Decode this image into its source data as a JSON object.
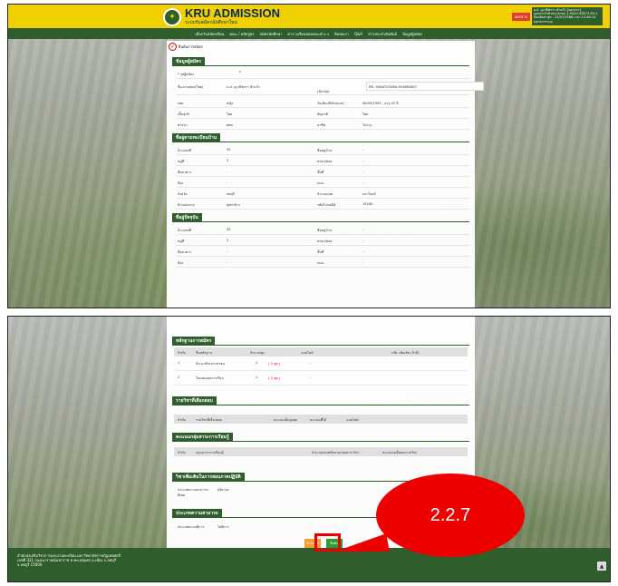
{
  "header": {
    "title": "KRU ADMISSION",
    "subtitle": "ระบบรับสมัครนักศึกษาใหม่",
    "user_badge": "ออกจาก",
    "user_lines": [
      "ผ.ส. ญาณีพรรา คำแก้ว [ออกจาก]",
      "เลขประจำตัวประชาชน 1-9420-47873-39-1",
      "ล็อคอินล่าสุด : 22/07/2566 เวลา 13:46:14",
      "ออกจากระบบ"
    ]
  },
  "nav": [
    "เลือกรับสมัครเรียน",
    "คณะ / หลักสูตร",
    "สมัครนักศึกษา",
    "ตารางเรียนของคณะต่าง ๆ",
    "ติดต่อเรา",
    "Q&A",
    "ข่าวประชาสัมพันธ์",
    "ข้อมูลผู้สมัคร"
  ],
  "confirm_label": "ยืนยันการสมัคร",
  "sections": {
    "applicant": "ข้อมูลผู้สมัคร",
    "house": "ที่อยู่ตามทะเบียนบ้าน",
    "current": "ที่อยู่ปัจจุบัน",
    "evidence": "หลักฐานการสมัคร",
    "subjects": "รายวิชาที่เลือกสอบ",
    "scores": "คะแนนกลุ่มสาระการเรียนรู้",
    "special": "วิชาเพิ่มเติมในการสอบภาคปฏิบัติ",
    "talent": "ประเภทความสามารถ"
  },
  "applicant": {
    "photo_label": "* รูปผู้สมัคร",
    "name_th_label": "ชื่อ-นามสกุล(ไทย)",
    "name_th": "น.ส. ญาณีพรรา คำแก้ว",
    "name_en_label": "(อังกฤษ)",
    "name_en": "MS. YANATCHARA KHAMKAEO",
    "sex_label": "เพศ",
    "sex": "หญิง",
    "dob_label": "วันเดือนปีเกิด(ค.ศ.)",
    "dob": "08/09/1999 , อายุ 22 ปี",
    "race_label": "เชื้อชาติ",
    "race": "ไทย",
    "nation_label": "สัญชาติ",
    "nation": "ไทย",
    "religion_label": "ศาสนา",
    "religion": "พุทธ",
    "job_label": "อาชีพ",
    "job": "ไม่ระบุ"
  },
  "house": {
    "no_label": "บ้านเลขที่",
    "no": "35",
    "village_label": "ชื่อหมู่บ้าน",
    "village": "-",
    "moo_label": "หมู่ที่",
    "moo": "2",
    "soi_label": "ตรอก/ซอย",
    "soi": "-",
    "building_label": "ชื่ออาคาร",
    "building": "-",
    "floor_label": "ชั้นที่",
    "floor": "-",
    "room_label": "ห้อง",
    "room": "-",
    "road_label": "ถนน",
    "road": "-",
    "province_label": "จังหวัด",
    "province": "ลพบุรี",
    "district_label": "อำเภอ/เขต",
    "district": "สระโบสถ์",
    "subdistrict_label": "ตำบล/แขวง",
    "subdistrict": "ทุ่งท่าช้าง",
    "zip_label": "รหัสไปรษณีย์",
    "zip": "15240"
  },
  "current": {
    "no_label": "บ้านเลขที่",
    "no": "35",
    "village_label": "ชื่อหมู่บ้าน",
    "village": "-",
    "moo_label": "หมู่ที่",
    "moo": "2",
    "soi_label": "ตรอก/ซอย",
    "soi": "-",
    "building_label": "ชื่ออาคาร",
    "building": "-",
    "floor_label": "ชั้นที่",
    "floor": "-",
    "room_label": "ห้อง",
    "room": "-",
    "road_label": "ถนน",
    "road": "-"
  },
  "evidence": {
    "headers": [
      "ลำดับ",
      "ชื่อหลักฐาน",
      "จำนวนชุด",
      "แนบไฟล์",
      "URL เพิ่มเติม (ถ้ามี)"
    ],
    "rows": [
      [
        "1",
        "สำเนาบัตรประชาชน",
        "1",
        "( 2 ชุด )",
        "-"
      ],
      [
        "2",
        "ใบแสดงผลการเรียน",
        "1",
        "( 2 ชุด )",
        "-"
      ]
    ]
  },
  "subjects": {
    "headers": [
      "ลำดับ",
      "รายวิชาที่เลือกสอบ",
      "คะแนนเต็มสูงสุด",
      "คะแนนที่ได้",
      "แนบไฟล์"
    ]
  },
  "scores": {
    "headers": [
      "ลำดับ",
      "กลุ่มสาระการเรียนรู้",
      "จำนวนหน่วยกิตตามกลุ่มสาระวิชา",
      "คะแนนเฉลี่ยของรายวิชา"
    ]
  },
  "special": {
    "label": "ประเภทความสามารถ\nพิเศษ",
    "value": "ดุริยางค"
  },
  "talent": {
    "label": "ประเภทความพิการ",
    "value": "ไม่พิการ"
  },
  "buttons": {
    "back": "ย้อนกลับ",
    "confirm": "ยืนยัน"
  },
  "footer": {
    "lines": [
      "สำนักส่งเสริมวิชาการและงานทะเบียน มหาวิทยาลัยราชภัฏเทพสตรี",
      "เลขที่ 321 ถนนนารายณ์มหาราช ต.ทะเลชุบศร อ.เมือง จ.ลพบุรี",
      "จ.ลพบุรี 15000"
    ]
  },
  "callout": "2.2.7",
  "colors": {
    "brand_green": "#2f5d2c",
    "brand_yellow": "#f0d000",
    "highlight_red": "#ee0000",
    "confirm_green": "#2f9d35",
    "back_orange": "#f0a030"
  }
}
